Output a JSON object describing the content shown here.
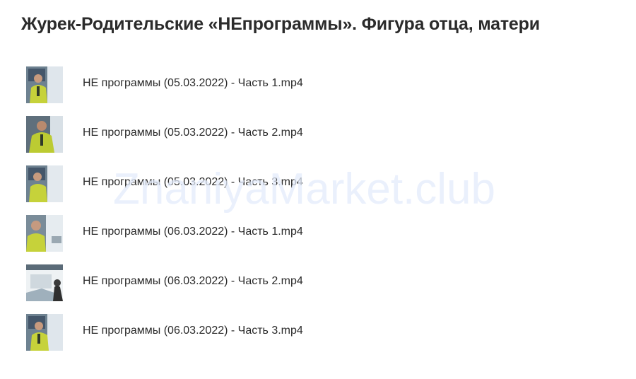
{
  "folder": {
    "title": "Журек-Родительские «НЕпрограммы». Фигура отца, матери"
  },
  "files": [
    {
      "name": "НЕ программы (05.03.2022) - Часть 1.mp4",
      "thumbnail_icon": "video-thumbnail-icon"
    },
    {
      "name": "НЕ программы (05.03.2022) - Часть 2.mp4",
      "thumbnail_icon": "video-thumbnail-icon"
    },
    {
      "name": "НЕ программы (05.03.2022) - Часть 3.mp4",
      "thumbnail_icon": "video-thumbnail-icon"
    },
    {
      "name": "НЕ программы (06.03.2022) - Часть 1.mp4",
      "thumbnail_icon": "video-thumbnail-icon"
    },
    {
      "name": "НЕ программы (06.03.2022) - Часть 2.mp4",
      "thumbnail_icon": "video-thumbnail-icon"
    },
    {
      "name": "НЕ программы (06.03.2022) - Часть 3.mp4",
      "thumbnail_icon": "video-thumbnail-icon"
    }
  ],
  "watermark": {
    "text": "ZnaniyaMarket.club"
  },
  "colors": {
    "text": "#2a2a2a",
    "watermark": "#e4ecfb",
    "thumb_jacket": "#c6d23a",
    "thumb_background": "#6d7f8c"
  }
}
